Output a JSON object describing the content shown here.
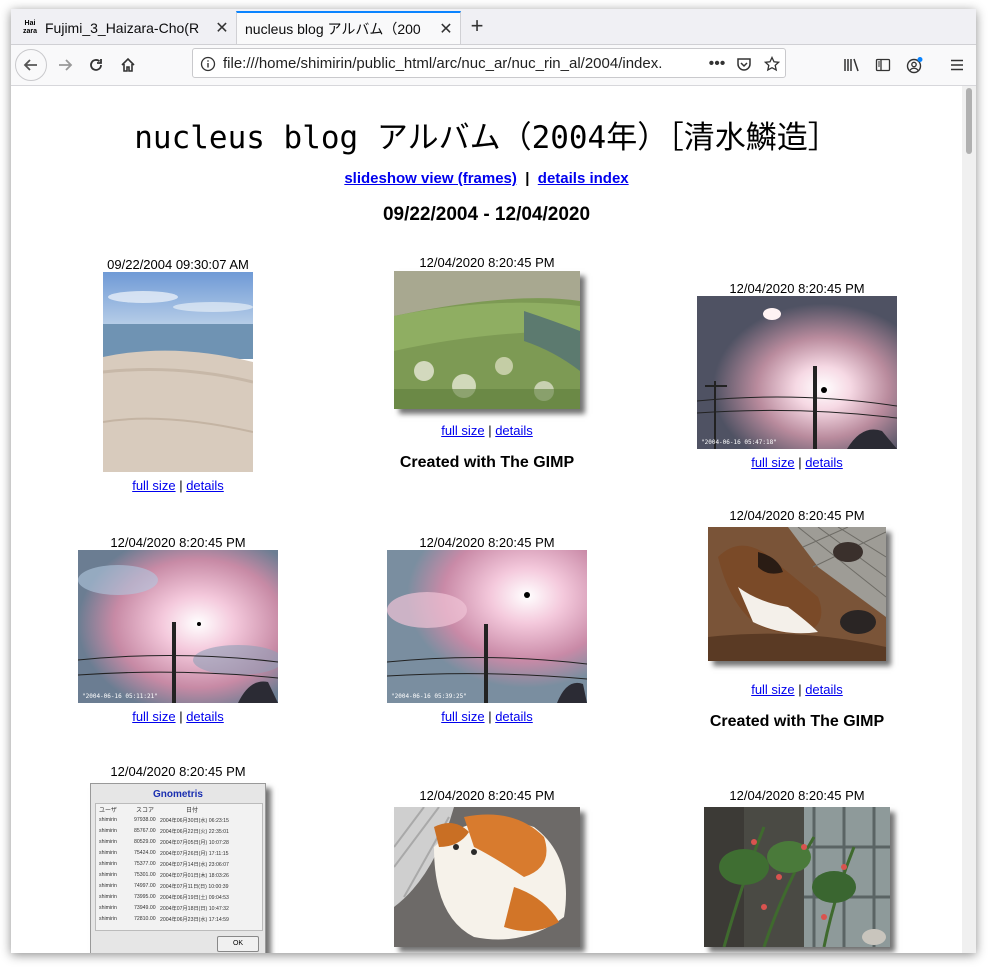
{
  "tabs": [
    {
      "label": "Fujimi_3_Haizara-Cho(R",
      "favicon_top": "Hai",
      "favicon_bottom": "zara",
      "active": false
    },
    {
      "label": "nucleus blog アルバム（200",
      "active": true
    }
  ],
  "new_tab_label": "+",
  "address": {
    "url": "file:///home/shimirin/public_html/arc/nuc_ar/nuc_rin_al/2004/index."
  },
  "page": {
    "title": "nucleus blog アルバム（2004年）［清水鱗造］",
    "slideshow_link": "slideshow view (frames)",
    "separator": "|",
    "details_index_link": "details index",
    "date_range": "09/22/2004 - 12/04/2020"
  },
  "photos": [
    {
      "timestamp": "09/22/2004 09:30:07 AM",
      "full_size": "full size",
      "sep": "|",
      "details": "details",
      "subject": "beach"
    },
    {
      "timestamp": "12/04/2020 8:20:45 PM",
      "full_size": "full size",
      "sep": "|",
      "details": "details",
      "caption": "Created with The GIMP",
      "subject": "field"
    },
    {
      "timestamp": "12/04/2020 8:20:45 PM",
      "full_size": "full size",
      "sep": "|",
      "details": "details",
      "subject": "sun",
      "stamp": "\"2004-06-16 05:47:18\""
    },
    {
      "timestamp": "12/04/2020 8:20:45 PM",
      "full_size": "full size",
      "sep": "|",
      "details": "details",
      "subject": "pink-sky",
      "stamp": "\"2004-06-16 05:11:21\""
    },
    {
      "timestamp": "12/04/2020 8:20:45 PM",
      "full_size": "full size",
      "sep": "|",
      "details": "details",
      "subject": "pink-sky",
      "stamp": "\"2004-06-16 05:39:25\""
    },
    {
      "timestamp": "12/04/2020 8:20:45 PM",
      "full_size": "full size",
      "sep": "|",
      "details": "details",
      "caption": "Created with The GIMP",
      "subject": "dog"
    },
    {
      "timestamp": "12/04/2020 8:20:45 PM",
      "subject": "gnometris"
    },
    {
      "timestamp": "12/04/2020 8:20:45 PM",
      "subject": "cat"
    },
    {
      "timestamp": "12/04/2020 8:20:45 PM",
      "subject": "plants"
    }
  ],
  "gnometris": {
    "title": "Gnometris",
    "headers": [
      "ユーザ",
      "スコア",
      "日付"
    ],
    "rows": [
      [
        "shimirin",
        "97938.00",
        "2004年06月30日(水) 06:23:15"
      ],
      [
        "shimirin",
        "85767.00",
        "2004年06月22日(火) 22:35:01"
      ],
      [
        "shimirin",
        "80529.00",
        "2004年07月05日(月) 10:07:28"
      ],
      [
        "shimirin",
        "75424.00",
        "2004年07月26日(月) 17:11:15"
      ],
      [
        "shimirin",
        "75377.00",
        "2004年07月14日(水) 23:06:07"
      ],
      [
        "shimirin",
        "75301.00",
        "2004年07月01日(木) 18:03:26"
      ],
      [
        "shimirin",
        "74997.00",
        "2004年07月11日(日) 10:00:39"
      ],
      [
        "shimirin",
        "73995.00",
        "2004年06月19日(土) 09:04:53"
      ],
      [
        "shimirin",
        "73949.00",
        "2004年07月18日(日) 10:47:32"
      ],
      [
        "shimirin",
        "72810.00",
        "2004年06月23日(水) 17:14:59"
      ]
    ],
    "ok_label": "OK"
  }
}
